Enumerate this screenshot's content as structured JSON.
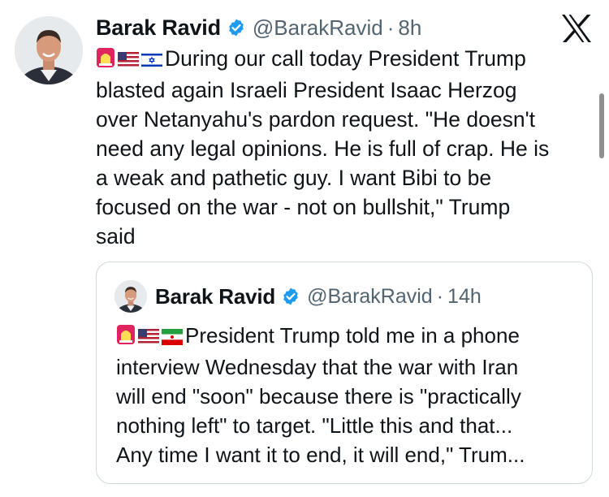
{
  "tweet": {
    "author_name": "Barak Ravid",
    "handle": "@BarakRavid",
    "separator": "·",
    "time": "8h",
    "emojis": [
      "rotating-light-emoji",
      "us-flag-emoji",
      "israel-flag-emoji"
    ],
    "lines": [
      "During our call today President Trump",
      "blasted again Israeli President Isaac Herzog",
      "over Netanyahu's pardon request. \"He doesn't",
      "need any legal opinions. He is full of crap. He is",
      "a weak and pathetic guy. I want Bibi to be",
      "focused on the war - not on bullshit,\" Trump",
      "said"
    ]
  },
  "quoted_tweet": {
    "author_name": "Barak Ravid",
    "handle": "@BarakRavid",
    "separator": "·",
    "time": "14h",
    "emojis": [
      "rotating-light-emoji",
      "us-flag-emoji",
      "iran-flag-emoji"
    ],
    "lines": [
      "President Trump told me in a phone",
      "interview Wednesday that the war with Iran",
      "will end \"soon\" because there is \"practically",
      "nothing left\" to target. \"Little this and that...",
      "Any time I want it to end, it will end,\" Trum..."
    ]
  },
  "icons": {
    "verified": "verified-badge-icon",
    "platform": "x-logo-icon"
  },
  "colors": {
    "text": "#0f1419",
    "secondary_text": "#536471",
    "verified_blue": "#1d9bf0",
    "border": "#cfd9de"
  }
}
